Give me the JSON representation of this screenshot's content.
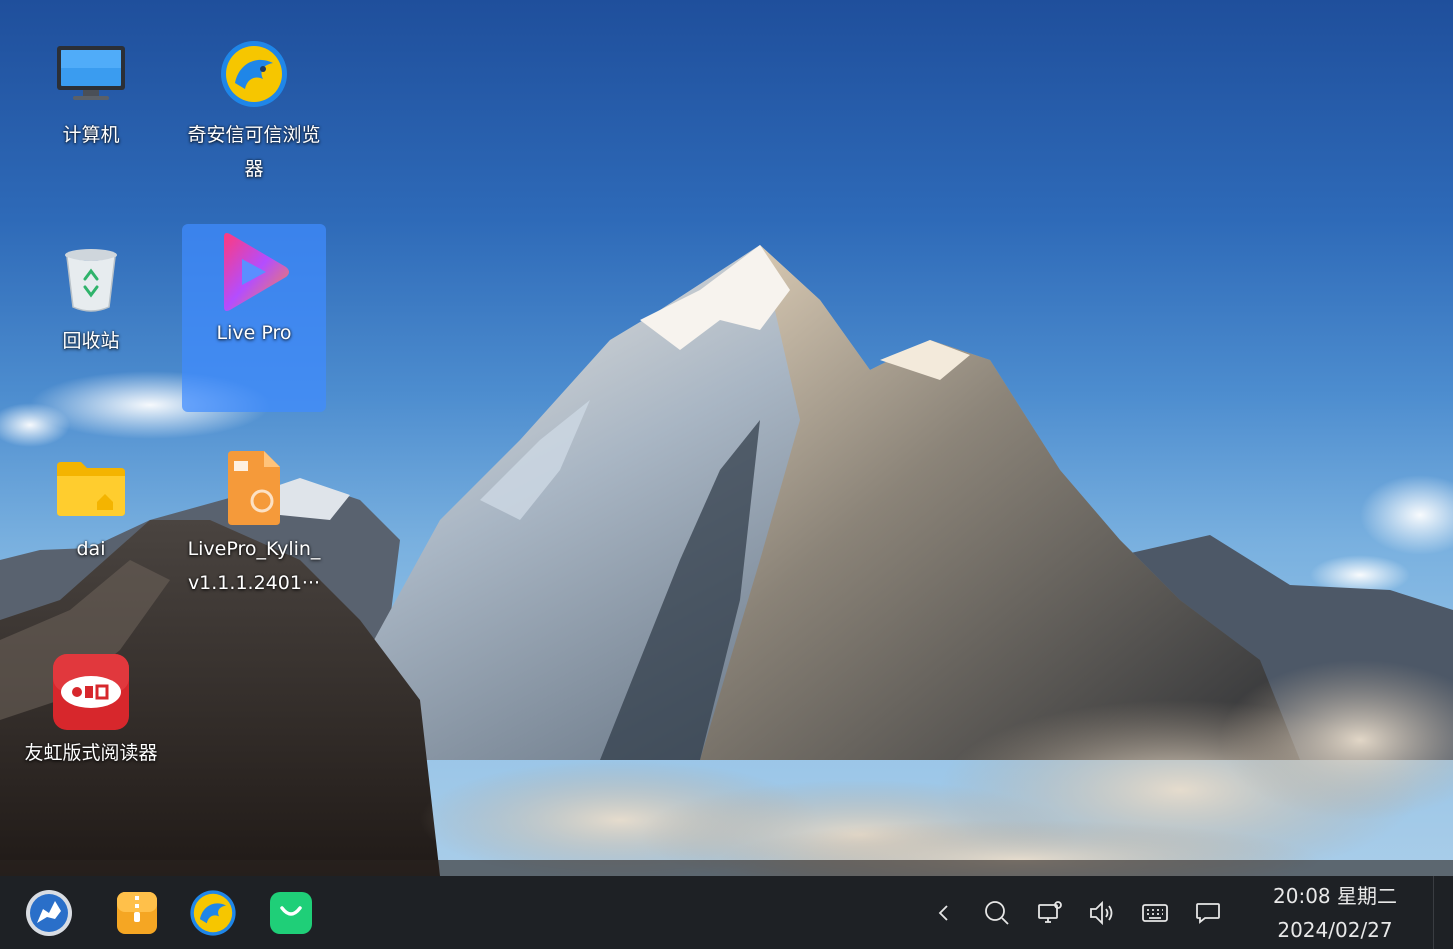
{
  "desktop": {
    "icons": [
      {
        "name": "computer",
        "label": "计算机"
      },
      {
        "name": "qianxin-browser",
        "label": "奇安信可信浏览器"
      },
      {
        "name": "recycle-bin",
        "label": "回收站"
      },
      {
        "name": "live-pro",
        "label": "Live Pro"
      },
      {
        "name": "home-folder",
        "label": "dai"
      },
      {
        "name": "livepro-package",
        "label": "LivePro_Kylin_v1.1.1.2401···"
      },
      {
        "name": "ofd-reader",
        "label": "友虹版式阅读器"
      }
    ]
  },
  "taskbar": {
    "apps": [
      {
        "name": "start-menu",
        "icon": "kylin-start-icon"
      },
      {
        "name": "archive-manager",
        "icon": "archive-icon"
      },
      {
        "name": "browser",
        "icon": "browser-icon"
      },
      {
        "name": "app-store",
        "icon": "shopping-bag-icon"
      }
    ],
    "tray": [
      {
        "name": "collapse-tray",
        "icon": "chevron-left-icon"
      },
      {
        "name": "search",
        "icon": "search-icon"
      },
      {
        "name": "network",
        "icon": "network-icon"
      },
      {
        "name": "volume",
        "icon": "volume-icon"
      },
      {
        "name": "input-method",
        "icon": "keyboard-icon"
      },
      {
        "name": "notifications",
        "icon": "message-icon"
      }
    ],
    "clock": {
      "time_weekday": "20:08 星期二",
      "date": "2024/02/27"
    }
  },
  "colors": {
    "taskbar_bg": "#1e2125",
    "selection": "#408cff"
  }
}
